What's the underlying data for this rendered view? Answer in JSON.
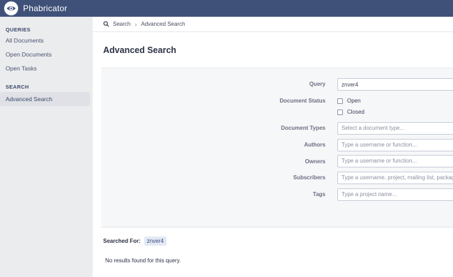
{
  "app": {
    "name": "Phabricator"
  },
  "sidebar": {
    "queries_header": "QUERIES",
    "items": [
      {
        "label": "All Documents"
      },
      {
        "label": "Open Documents"
      },
      {
        "label": "Open Tasks"
      }
    ],
    "search_header": "SEARCH",
    "advanced_search": {
      "label": "Advanced Search"
    }
  },
  "breadcrumb": {
    "items": [
      {
        "label": "Search"
      },
      {
        "label": "Advanced Search"
      }
    ]
  },
  "page": {
    "title": "Advanced Search"
  },
  "form": {
    "query": {
      "label": "Query",
      "value": "znver4"
    },
    "document_status": {
      "label": "Document Status",
      "options": [
        {
          "label": "Open",
          "checked": false
        },
        {
          "label": "Closed",
          "checked": false
        }
      ]
    },
    "document_types": {
      "label": "Document Types",
      "placeholder": "Select a document type..."
    },
    "authors": {
      "label": "Authors",
      "placeholder": "Type a username or function..."
    },
    "owners": {
      "label": "Owners",
      "placeholder": "Type a username or function..."
    },
    "subscribers": {
      "label": "Subscribers",
      "placeholder": "Type a username, project, mailing list, package"
    },
    "tags": {
      "label": "Tags",
      "placeholder": "Type a project name..."
    }
  },
  "results": {
    "searched_for_label": "Searched For:",
    "token": "znver4",
    "empty_message": "No results found for this query."
  }
}
